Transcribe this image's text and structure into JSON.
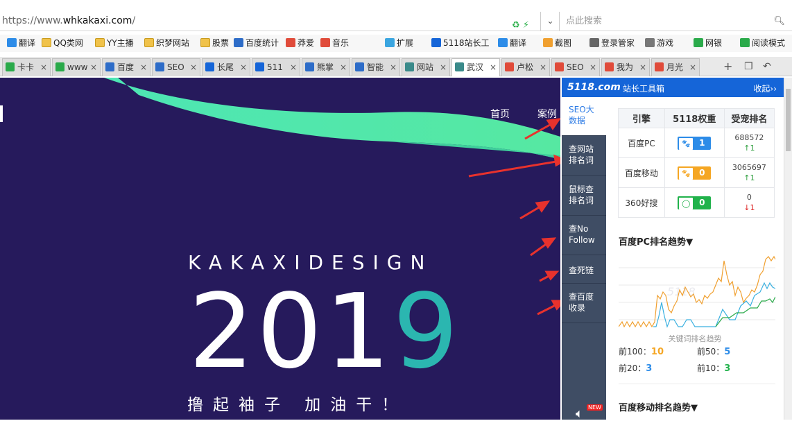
{
  "address_bar": {
    "url_prefix": "https://www.",
    "url_domain": "whkakaxi.com",
    "url_suffix": "/",
    "search_placeholder": "点此搜索"
  },
  "bookmarks": [
    {
      "label": "翻译",
      "icon": "translate-icon"
    },
    {
      "label": "QQ类网",
      "icon": "folder-icon"
    },
    {
      "label": "YY主播",
      "icon": "folder-icon"
    },
    {
      "label": "织梦网站",
      "icon": "folder-icon"
    },
    {
      "label": "股票",
      "icon": "folder-icon"
    },
    {
      "label": "百度统计",
      "icon": "chart-icon"
    },
    {
      "label": "莽爱",
      "icon": "heart-icon"
    },
    {
      "label": "音乐",
      "icon": "music-icon"
    },
    {
      "label": "扩展",
      "icon": "extension-icon"
    },
    {
      "label": "5118站长工",
      "icon": "5118-icon"
    },
    {
      "label": "翻译",
      "icon": "translate-icon"
    },
    {
      "label": "截图",
      "icon": "scissors-icon"
    },
    {
      "label": "登录管家",
      "icon": "key-icon"
    },
    {
      "label": "游戏",
      "icon": "gamepad-icon"
    },
    {
      "label": "网银",
      "icon": "bank-icon"
    },
    {
      "label": "阅读模式",
      "icon": "book-icon"
    }
  ],
  "tabs": [
    {
      "label": "卡卡",
      "icon": "tab-icon"
    },
    {
      "label": "www",
      "icon": "tab-icon"
    },
    {
      "label": "百度",
      "icon": "baidu-icon"
    },
    {
      "label": "SEO",
      "icon": "baidu-icon"
    },
    {
      "label": "长尾",
      "icon": "5118-icon"
    },
    {
      "label": "511",
      "icon": "5118-icon"
    },
    {
      "label": "熊掌",
      "icon": "baidu-icon"
    },
    {
      "label": "智能",
      "icon": "baidu-icon"
    },
    {
      "label": "网站",
      "icon": "site-icon"
    },
    {
      "label": "武汉",
      "icon": "site-icon",
      "active": true
    },
    {
      "label": "卢松",
      "icon": "trend-icon"
    },
    {
      "label": "SEO",
      "icon": "trend-icon"
    },
    {
      "label": "我为",
      "icon": "trend-icon"
    },
    {
      "label": "月光",
      "icon": "trend-icon"
    }
  ],
  "page": {
    "nav_home": "首页",
    "nav_cases": "案例",
    "brand": "KAKAXIDESIGN",
    "year_main": "201",
    "year_last": "9",
    "slogan": "撸起袖子 加油干！"
  },
  "toolbox": {
    "logo": "5118.com",
    "name": "站长工具箱",
    "collapse": "收起››",
    "side_buttons": [
      {
        "line1": "SEO大",
        "line2": "数据"
      },
      {
        "line1": "查网站",
        "line2": "排名词"
      },
      {
        "line1": "鼠标查",
        "line2": "排名词"
      },
      {
        "line1": "查No",
        "line2": "Follow"
      },
      {
        "line1": "查死链",
        "line2": ""
      },
      {
        "line1": "查百度",
        "line2": "收录"
      }
    ],
    "new_badge": "NEW",
    "table": {
      "headers": [
        "引擎",
        "5118权重",
        "受宠排名"
      ],
      "rows": [
        {
          "engine": "百度PC",
          "weight": "1",
          "rank": "688572",
          "trend": "↑1",
          "trend_dir": "up",
          "color": "#2d8ce8"
        },
        {
          "engine": "百度移动",
          "weight": "0",
          "rank": "3065697",
          "trend": "↑1",
          "trend_dir": "up",
          "color": "#f5a623"
        },
        {
          "engine": "360好搜",
          "weight": "0",
          "rank": "0",
          "trend": "↓1",
          "trend_dir": "down",
          "color": "#21b24b"
        }
      ]
    },
    "pc_trend_title": "百度PC排名趋势▼",
    "chart_caption": "关键词排名趋势",
    "stats": {
      "top100_label": "前100：",
      "top100": "10",
      "top50_label": "前50：",
      "top50": "5",
      "top20_label": "前20：",
      "top20": "3",
      "top10_label": "前10：",
      "top10": "3"
    },
    "mobile_trend_title": "百度移动排名趋势▼"
  }
}
